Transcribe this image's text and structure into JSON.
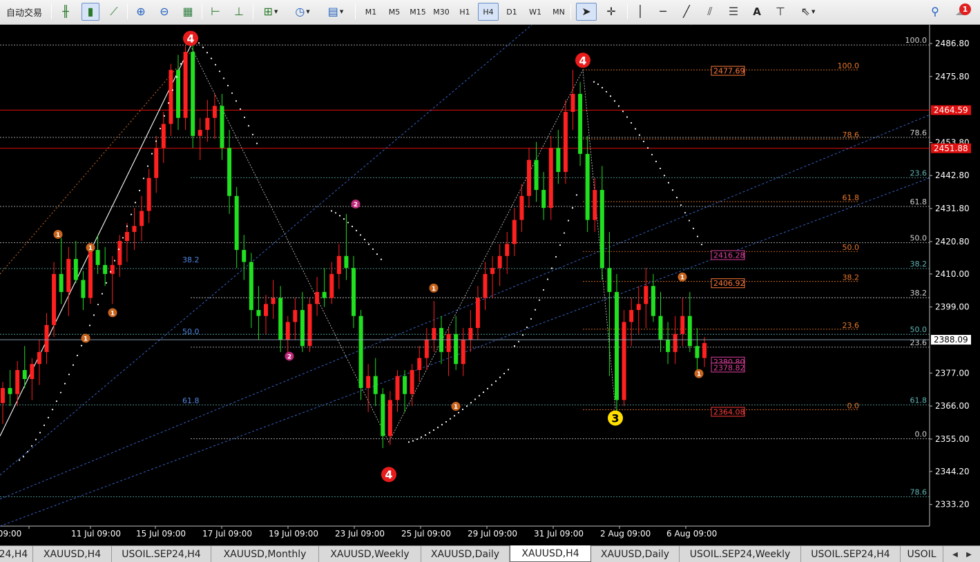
{
  "toolbar": {
    "auto_trading_label": "自动交易",
    "timeframes": [
      "M1",
      "M5",
      "M15",
      "M30",
      "H1",
      "H4",
      "D1",
      "W1",
      "MN"
    ],
    "active_timeframe": "H4",
    "text_tool_label": "A",
    "notification_count": "1"
  },
  "chart_data": {
    "type": "candlestick",
    "symbol": "XAUUSD",
    "timeframe": "H4",
    "ylim": [
      2326.0,
      2493.0
    ],
    "price_ticks": [
      {
        "value": 2486.8,
        "label": "2486.80"
      },
      {
        "value": 2475.8,
        "label": "2475.80"
      },
      {
        "value": 2453.8,
        "label": "2453.80"
      },
      {
        "value": 2442.8,
        "label": "2442.80"
      },
      {
        "value": 2431.8,
        "label": "2431.80"
      },
      {
        "value": 2420.8,
        "label": "2420.80"
      },
      {
        "value": 2410.0,
        "label": "2410.00"
      },
      {
        "value": 2399.0,
        "label": "2399.00"
      },
      {
        "value": 2377.0,
        "label": "2377.00"
      },
      {
        "value": 2366.0,
        "label": "2366.00"
      },
      {
        "value": 2355.0,
        "label": "2355.00"
      },
      {
        "value": 2344.2,
        "label": "2344.20"
      },
      {
        "value": 2333.2,
        "label": "2333.20"
      }
    ],
    "time_labels": [
      "09:00",
      "11 Jul 09:00",
      "15 Jul 09:00",
      "17 Jul 09:00",
      "19 Jul 09:00",
      "23 Jul 09:00",
      "25 Jul 09:00",
      "29 Jul 09:00",
      "31 Jul 09:00",
      "2 Aug 09:00",
      "6 Aug 09:00"
    ],
    "current_price": {
      "value": 2388.09,
      "label": "2388.09"
    },
    "red_levels": [
      {
        "value": 2464.59,
        "label": "2464.59"
      },
      {
        "value": 2451.88,
        "label": "2451.88"
      }
    ],
    "price_callouts": [
      {
        "value": 2477.69,
        "label": "2477.69",
        "color": "#ff7a3c"
      },
      {
        "value": 2416.28,
        "label": "2416.28",
        "color": "#e040a0"
      },
      {
        "value": 2406.92,
        "label": "2406.92",
        "color": "#ff7a3c"
      },
      {
        "value": 2380.8,
        "label": "2380.80",
        "color": "#e040a0"
      },
      {
        "value": 2378.82,
        "label": "2378.82",
        "color": "#e040a0"
      },
      {
        "value": 2364.08,
        "label": "2364.08",
        "color": "#ff3c3c"
      }
    ],
    "fib_right_white": [
      {
        "value": 2486.3,
        "label": "100.0"
      },
      {
        "value": 2455.5,
        "label": "78.6"
      },
      {
        "value": 2442.1,
        "label": "23.6"
      },
      {
        "value": 2432.5,
        "label": "61.8"
      },
      {
        "value": 2420.4,
        "label": "50.0"
      },
      {
        "value": 2411.8,
        "label": "38.2"
      },
      {
        "value": 2402.1,
        "label": "38.2"
      },
      {
        "value": 2389.9,
        "label": "50.0"
      },
      {
        "value": 2385.6,
        "label": "23.6"
      },
      {
        "value": 2366.4,
        "label": "61.8"
      },
      {
        "value": 2355.1,
        "label": "0.0"
      },
      {
        "value": 2335.8,
        "label": "78.6"
      }
    ],
    "fib_orange": [
      {
        "value": 2478.0,
        "label": "100.0"
      },
      {
        "value": 2455.0,
        "label": "78.6"
      },
      {
        "value": 2434.1,
        "label": "61.8"
      },
      {
        "value": 2417.5,
        "label": "50.0"
      },
      {
        "value": 2407.5,
        "label": "38.2"
      },
      {
        "value": 2391.6,
        "label": "23.6"
      },
      {
        "value": 2364.8,
        "label": "0.0"
      }
    ],
    "fib_left_blue": [
      {
        "value": 2413.0,
        "label": "38.2"
      },
      {
        "value": 2389.0,
        "label": "50.0"
      },
      {
        "value": 2366.0,
        "label": "61.8"
      }
    ],
    "wave_labels": [
      {
        "text": "4",
        "x": 276,
        "value": 2488.5,
        "kind": "red"
      },
      {
        "text": "4",
        "x": 844,
        "value": 2481.2,
        "kind": "red"
      },
      {
        "text": "4",
        "x": 563,
        "value": 2343.2,
        "kind": "red"
      },
      {
        "text": "3",
        "x": 891,
        "value": 2362.0,
        "kind": "yellow"
      },
      {
        "text": "2",
        "x": 515,
        "value": 2433.3,
        "kind": "magenta"
      },
      {
        "text": "2",
        "x": 419,
        "value": 2382.6,
        "kind": "magenta"
      },
      {
        "text": "1",
        "x": 84,
        "value": 2423.2,
        "kind": "orange"
      },
      {
        "text": "1",
        "x": 131,
        "value": 2418.8,
        "kind": "orange"
      },
      {
        "text": "1",
        "x": 163,
        "value": 2397.1,
        "kind": "orange"
      },
      {
        "text": "1",
        "x": 124,
        "value": 2388.6,
        "kind": "orange"
      },
      {
        "text": "1",
        "x": 628,
        "value": 2405.3,
        "kind": "orange"
      },
      {
        "text": "1",
        "x": 660,
        "value": 2365.9,
        "kind": "orange"
      },
      {
        "text": "1",
        "x": 988,
        "value": 2409.0,
        "kind": "orange"
      },
      {
        "text": "1",
        "x": 1012,
        "value": 2376.8,
        "kind": "orange"
      }
    ],
    "candles": [
      [
        2367,
        2374,
        2360,
        2372
      ],
      [
        2372,
        2378,
        2366,
        2370
      ],
      [
        2370,
        2381,
        2366,
        2378
      ],
      [
        2378,
        2386,
        2372,
        2375
      ],
      [
        2375,
        2382,
        2368,
        2380
      ],
      [
        2380,
        2388,
        2373,
        2384
      ],
      [
        2384,
        2397,
        2380,
        2393
      ],
      [
        2393,
        2414,
        2389,
        2410
      ],
      [
        2410,
        2422,
        2400,
        2404
      ],
      [
        2404,
        2419,
        2396,
        2415
      ],
      [
        2415,
        2421,
        2407,
        2408
      ],
      [
        2408,
        2411,
        2398,
        2402
      ],
      [
        2402,
        2420,
        2400,
        2418
      ],
      [
        2418,
        2423,
        2410,
        2413
      ],
      [
        2413,
        2419,
        2406,
        2410
      ],
      [
        2410,
        2416,
        2400,
        2413
      ],
      [
        2413,
        2423,
        2409,
        2421
      ],
      [
        2421,
        2427,
        2414,
        2424
      ],
      [
        2424,
        2432,
        2418,
        2426
      ],
      [
        2426,
        2436,
        2421,
        2431
      ],
      [
        2431,
        2445,
        2427,
        2442
      ],
      [
        2442,
        2456,
        2437,
        2452
      ],
      [
        2452,
        2464,
        2447,
        2460
      ],
      [
        2460,
        2480,
        2456,
        2478
      ],
      [
        2478,
        2483,
        2458,
        2462
      ],
      [
        2462,
        2486,
        2458,
        2484
      ],
      [
        2484,
        2487,
        2452,
        2456
      ],
      [
        2456,
        2462,
        2448,
        2458
      ],
      [
        2458,
        2468,
        2454,
        2462
      ],
      [
        2462,
        2470,
        2455,
        2466
      ],
      [
        2466,
        2470,
        2448,
        2452
      ],
      [
        2452,
        2458,
        2430,
        2436
      ],
      [
        2436,
        2439,
        2412,
        2418
      ],
      [
        2418,
        2423,
        2408,
        2414
      ],
      [
        2414,
        2417,
        2392,
        2398
      ],
      [
        2398,
        2406,
        2388,
        2396
      ],
      [
        2396,
        2403,
        2390,
        2400
      ],
      [
        2400,
        2408,
        2395,
        2402
      ],
      [
        2402,
        2406,
        2384,
        2388
      ],
      [
        2388,
        2396,
        2382,
        2394
      ],
      [
        2394,
        2402,
        2388,
        2398
      ],
      [
        2398,
        2404,
        2384,
        2386
      ],
      [
        2386,
        2402,
        2384,
        2400
      ],
      [
        2400,
        2409,
        2396,
        2404
      ],
      [
        2404,
        2412,
        2399,
        2402
      ],
      [
        2402,
        2414,
        2400,
        2410
      ],
      [
        2410,
        2420,
        2405,
        2416
      ],
      [
        2416,
        2430,
        2408,
        2412
      ],
      [
        2412,
        2416,
        2392,
        2396
      ],
      [
        2396,
        2398,
        2368,
        2372
      ],
      [
        2372,
        2380,
        2364,
        2376
      ],
      [
        2376,
        2382,
        2366,
        2370
      ],
      [
        2370,
        2372,
        2352,
        2356
      ],
      [
        2356,
        2371,
        2353,
        2368
      ],
      [
        2368,
        2378,
        2364,
        2376
      ],
      [
        2376,
        2378,
        2364,
        2370
      ],
      [
        2370,
        2380,
        2366,
        2378
      ],
      [
        2378,
        2386,
        2374,
        2382
      ],
      [
        2382,
        2392,
        2378,
        2388
      ],
      [
        2388,
        2401,
        2384,
        2392
      ],
      [
        2392,
        2396,
        2380,
        2384
      ],
      [
        2384,
        2392,
        2376,
        2390
      ],
      [
        2390,
        2396,
        2378,
        2380
      ],
      [
        2380,
        2392,
        2376,
        2388
      ],
      [
        2388,
        2398,
        2384,
        2392
      ],
      [
        2392,
        2406,
        2388,
        2402
      ],
      [
        2402,
        2414,
        2398,
        2410
      ],
      [
        2410,
        2416,
        2402,
        2412
      ],
      [
        2412,
        2420,
        2406,
        2416
      ],
      [
        2416,
        2424,
        2410,
        2420
      ],
      [
        2420,
        2432,
        2416,
        2428
      ],
      [
        2428,
        2440,
        2424,
        2436
      ],
      [
        2436,
        2452,
        2432,
        2448
      ],
      [
        2448,
        2454,
        2434,
        2438
      ],
      [
        2438,
        2444,
        2428,
        2432
      ],
      [
        2432,
        2456,
        2428,
        2452
      ],
      [
        2452,
        2458,
        2440,
        2444
      ],
      [
        2444,
        2468,
        2440,
        2464
      ],
      [
        2464,
        2478,
        2458,
        2470
      ],
      [
        2470,
        2474,
        2446,
        2450
      ],
      [
        2450,
        2456,
        2424,
        2428
      ],
      [
        2428,
        2442,
        2424,
        2438
      ],
      [
        2438,
        2446,
        2408,
        2412
      ],
      [
        2412,
        2424,
        2376,
        2404
      ],
      [
        2404,
        2410,
        2364,
        2368
      ],
      [
        2368,
        2398,
        2366,
        2394
      ],
      [
        2394,
        2402,
        2386,
        2398
      ],
      [
        2398,
        2406,
        2390,
        2400
      ],
      [
        2400,
        2412,
        2392,
        2406
      ],
      [
        2406,
        2410,
        2394,
        2396
      ],
      [
        2396,
        2404,
        2384,
        2388
      ],
      [
        2388,
        2394,
        2380,
        2384
      ],
      [
        2384,
        2396,
        2380,
        2390
      ],
      [
        2390,
        2402,
        2386,
        2396
      ],
      [
        2396,
        2404,
        2384,
        2386
      ],
      [
        2386,
        2392,
        2378,
        2382
      ],
      [
        2382,
        2389,
        2379,
        2387
      ]
    ]
  },
  "tabs": [
    {
      "label": "24,H4"
    },
    {
      "label": "XAUUSD,H4"
    },
    {
      "label": "USOIL.SEP24,H4"
    },
    {
      "label": "XAUUSD,Monthly"
    },
    {
      "label": "XAUUSD,Weekly"
    },
    {
      "label": "XAUUSD,Daily"
    },
    {
      "label": "XAUUSD,H4",
      "active": true
    },
    {
      "label": "XAUUSD,Daily"
    },
    {
      "label": "USOIL.SEP24,Weekly"
    },
    {
      "label": "USOIL.SEP24,H4"
    },
    {
      "label": "USOIL"
    }
  ]
}
